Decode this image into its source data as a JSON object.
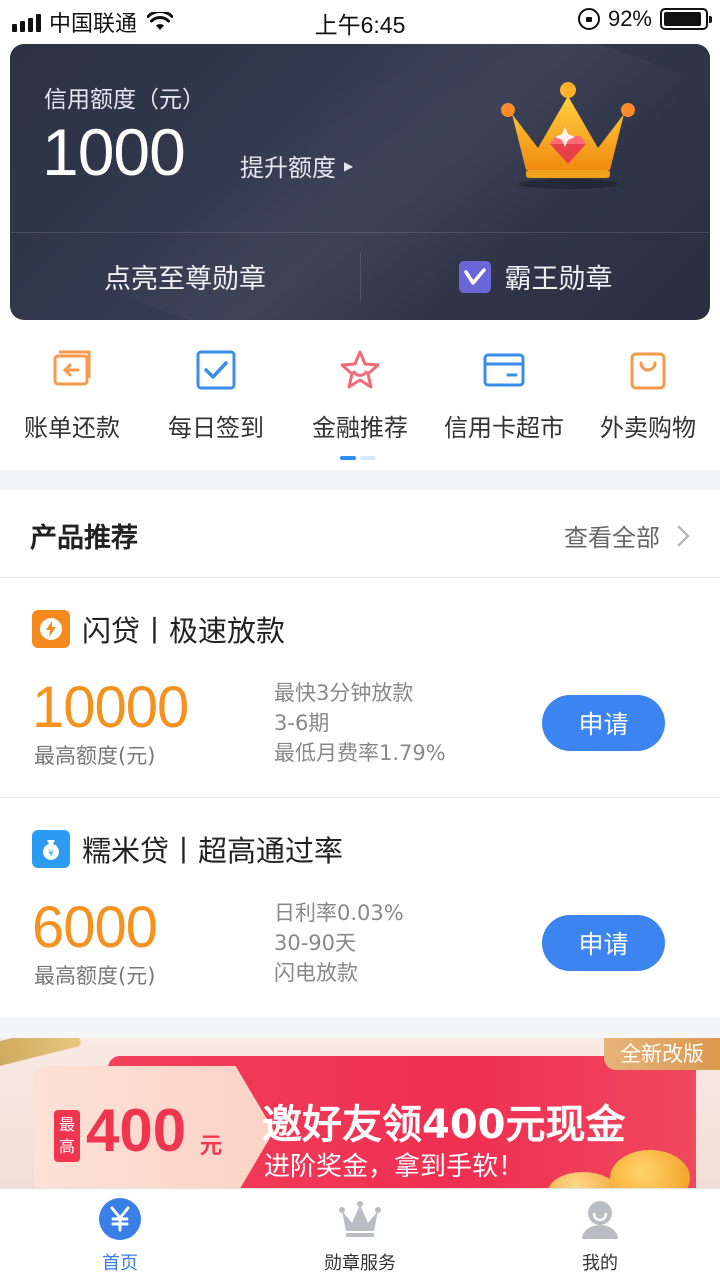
{
  "status_bar": {
    "carrier": "中国联通",
    "time": "上午6:45",
    "battery_percent": "92%",
    "battery_level": 0.92
  },
  "credit_card": {
    "label": "信用额度（元）",
    "amount": "1000",
    "raise_link": "提升额度",
    "badge_left": "点亮至尊勋章",
    "badge_right": "霸王勋章",
    "icons": [
      "crown-icon",
      "v-badge-icon"
    ]
  },
  "quick_menu": {
    "items": [
      {
        "label": "账单还款",
        "icon": "bill-repay-icon",
        "color": "#f59a4a"
      },
      {
        "label": "每日签到",
        "icon": "checkin-icon",
        "color": "#3a8ee8"
      },
      {
        "label": "金融推荐",
        "icon": "star-icon",
        "color": "#ef6b7a"
      },
      {
        "label": "信用卡超市",
        "icon": "card-icon",
        "color": "#3a8ee8"
      },
      {
        "label": "外卖购物",
        "icon": "shopping-bag-icon",
        "color": "#f59a4a"
      }
    ],
    "page_count": 2,
    "current_page": 1
  },
  "products": {
    "title": "产品推荐",
    "view_all": "查看全部",
    "items": [
      {
        "name": "闪贷丨极速放款",
        "icon": "lightning-icon",
        "icon_color": "#f58a1f",
        "amount": "10000",
        "amount_label": "最高额度(元)",
        "features": [
          "最快3分钟放款",
          "3-6期",
          "最低月费率1.79%"
        ],
        "apply_label": "申请"
      },
      {
        "name": "糯米贷丨超高通过率",
        "icon": "money-bag-icon",
        "icon_color": "#2b9cf2",
        "amount": "6000",
        "amount_label": "最高额度(元)",
        "features": [
          "日利率0.03%",
          "30-90天",
          "闪电放款"
        ],
        "apply_label": "申请"
      }
    ]
  },
  "banner": {
    "tag": "全新改版",
    "max_label": "最高",
    "amount": "400",
    "unit": "元",
    "title": "邀好友领400元现金",
    "subtitle": "进阶奖金，拿到手软！"
  },
  "tab_bar": {
    "tabs": [
      {
        "label": "首页",
        "icon": "yuan-icon",
        "active": true
      },
      {
        "label": "勋章服务",
        "icon": "crown-tab-icon",
        "active": false
      },
      {
        "label": "我的",
        "icon": "user-icon",
        "active": false
      }
    ],
    "accent": "#3a7ee8"
  }
}
